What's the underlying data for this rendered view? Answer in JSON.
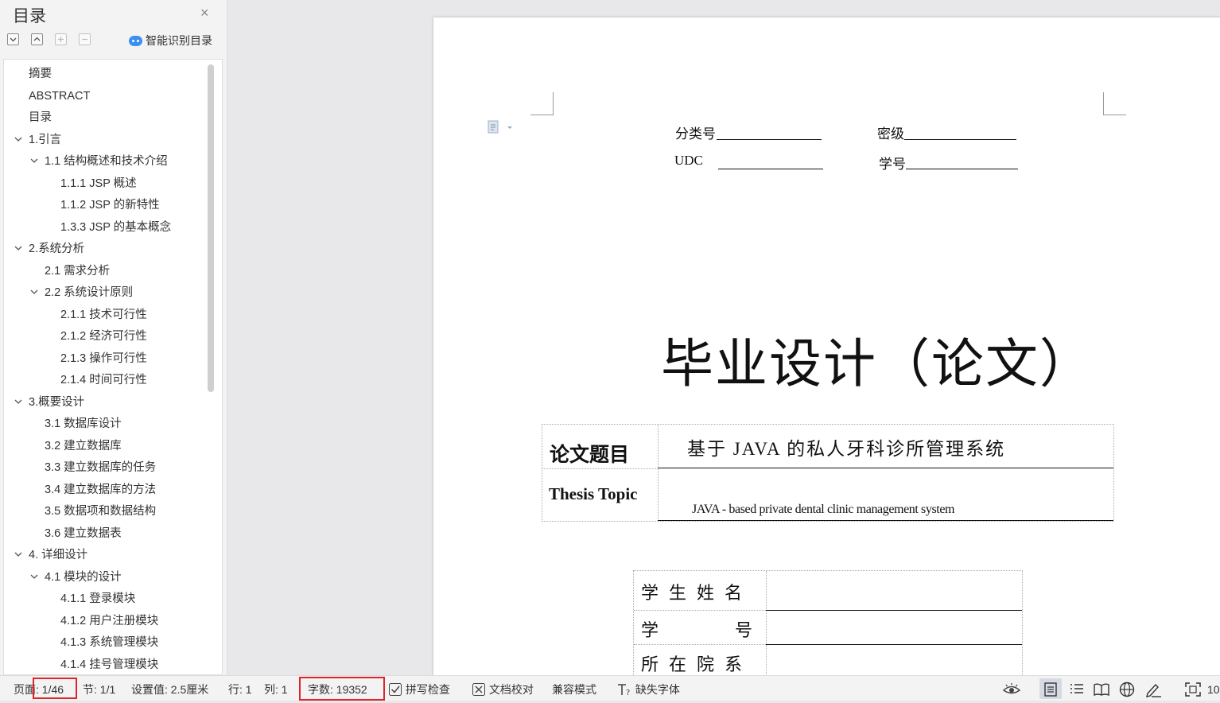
{
  "sidebar": {
    "title": "目录",
    "close_glyph": "×",
    "smart_toc_label": "智能识别目录",
    "toolbar_icons": [
      "expand-all-icon",
      "collapse-all-icon",
      "add-heading-icon",
      "remove-heading-icon"
    ],
    "toc": [
      {
        "label": "摘要",
        "level": 1,
        "chevron": false
      },
      {
        "label": "ABSTRACT",
        "level": 1,
        "chevron": false
      },
      {
        "label": "目录",
        "level": 1,
        "chevron": false
      },
      {
        "label": "1.引言",
        "level": 1,
        "chevron": true
      },
      {
        "label": "1.1 结构概述和技术介绍",
        "level": 2,
        "chevron": true
      },
      {
        "label": "1.1.1 JSP 概述",
        "level": 3,
        "chevron": false
      },
      {
        "label": "1.1.2 JSP 的新特性",
        "level": 3,
        "chevron": false
      },
      {
        "label": "1.3.3 JSP 的基本概念",
        "level": 3,
        "chevron": false
      },
      {
        "label": "2.系统分析",
        "level": 1,
        "chevron": true
      },
      {
        "label": "2.1  需求分析",
        "level": 2,
        "chevron": false
      },
      {
        "label": "2.2  系统设计原则",
        "level": 2,
        "chevron": true
      },
      {
        "label": "2.1.1 技术可行性",
        "level": 3,
        "chevron": false
      },
      {
        "label": "2.1.2  经济可行性",
        "level": 3,
        "chevron": false
      },
      {
        "label": "2.1.3  操作可行性",
        "level": 3,
        "chevron": false
      },
      {
        "label": "2.1.4  时间可行性",
        "level": 3,
        "chevron": false
      },
      {
        "label": "3.概要设计",
        "level": 1,
        "chevron": true
      },
      {
        "label": "3.1  数据库设计",
        "level": 2,
        "chevron": false
      },
      {
        "label": "3.2  建立数据库",
        "level": 2,
        "chevron": false
      },
      {
        "label": "3.3 建立数据库的任务",
        "level": 2,
        "chevron": false
      },
      {
        "label": "3.4  建立数据库的方法",
        "level": 2,
        "chevron": false
      },
      {
        "label": "3.5  数据项和数据结构",
        "level": 2,
        "chevron": false
      },
      {
        "label": "3.6  建立数据表",
        "level": 2,
        "chevron": false
      },
      {
        "label": "4.  详细设计",
        "level": 1,
        "chevron": true
      },
      {
        "label": "4.1  模块的设计",
        "level": 2,
        "chevron": true
      },
      {
        "label": "4.1.1  登录模块",
        "level": 3,
        "chevron": false
      },
      {
        "label": "4.1.2  用户注册模块",
        "level": 3,
        "chevron": false
      },
      {
        "label": "4.1.3  系统管理模块",
        "level": 3,
        "chevron": false
      },
      {
        "label": "4.1.4  挂号管理模块",
        "level": 3,
        "chevron": false
      }
    ]
  },
  "document": {
    "classification_label": "分类号",
    "secret_label": "密级",
    "udc_label": "UDC",
    "student_no_label": "学号",
    "main_title": "毕业设计（论文）",
    "thesis_title_cn_label": "论文题目",
    "thesis_title_cn": "基于 JAVA 的私人牙科诊所管理系统",
    "thesis_title_en_label": "Thesis Topic",
    "thesis_title_en": "JAVA - based private dental clinic management system",
    "student_name_label": "学生姓名",
    "student_id_label": "学号",
    "department_label": "所在院系"
  },
  "statusbar": {
    "page": "页面: 1/46",
    "section": "节: 1/1",
    "setting": "设置值: 2.5厘米",
    "line": "行: 1",
    "column": "列: 1",
    "word_count": "字数: 19352",
    "spell_check": "拼写检查",
    "doc_proof": "文档校对",
    "compat_mode": "兼容模式",
    "missing_font": "缺失字体",
    "zoom_partial": "10",
    "highlight_color": "#e0242a"
  }
}
